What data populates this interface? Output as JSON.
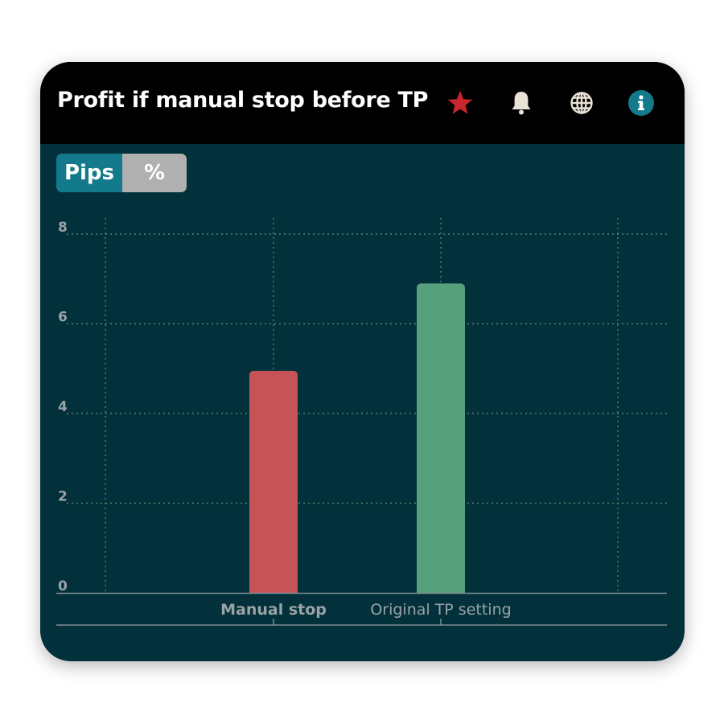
{
  "header": {
    "title": "Profit if manual stop before TP",
    "icons": [
      "star-icon",
      "bell-icon",
      "globe-icon",
      "info-icon"
    ],
    "star_color": "#c8262e",
    "bell_color": "#e9e2d6",
    "globe_color": "#e9e2d6",
    "info_color": "#137a8c"
  },
  "toggle": {
    "options": [
      "Pips",
      "%"
    ],
    "selected": "Pips",
    "active_color": "#137a8c",
    "inactive_color": "#b0b0b0"
  },
  "colors": {
    "card_bg": "#03313b",
    "header_bg": "#000000",
    "grid": "#5f7d6f",
    "axis": "#7f8f94",
    "tick_text": "#9aa3a6"
  },
  "chart_data": {
    "type": "bar",
    "title": "",
    "xlabel": "",
    "ylabel": "",
    "categories": [
      "Manual stop",
      "Original TP setting"
    ],
    "values": [
      4.95,
      6.9
    ],
    "bar_colors": [
      "#c65456",
      "#56a07e"
    ],
    "highlighted_category": "Manual stop",
    "ylim": [
      0,
      8
    ],
    "yticks": [
      "0",
      "2",
      "4",
      "6",
      "8"
    ],
    "grid": true,
    "legend": "none"
  }
}
